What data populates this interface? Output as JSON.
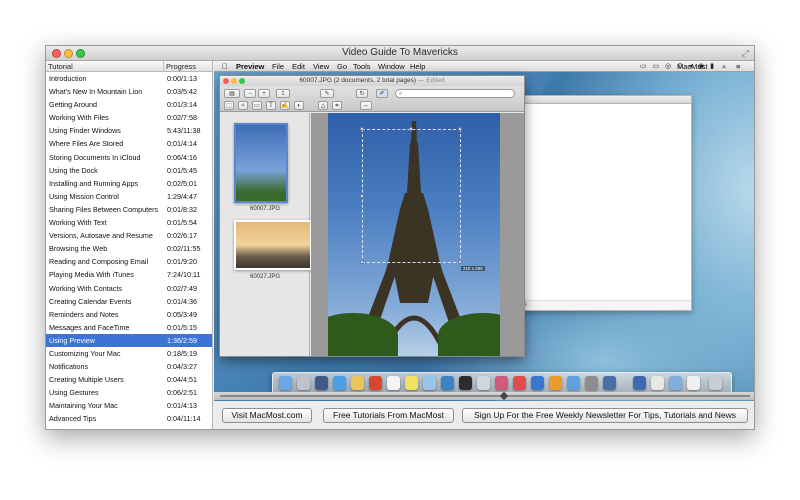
{
  "window": {
    "title": "Video Guide To Mavericks"
  },
  "sidebar": {
    "header_tutorial": "Tutorial",
    "header_progress": "Progress",
    "rows": [
      {
        "name": "Introduction",
        "progress": "0:00/1:13"
      },
      {
        "name": "What's New In Mountain Lion",
        "progress": "0:03/5:42"
      },
      {
        "name": "Getting Around",
        "progress": "0:01/3:14"
      },
      {
        "name": "Working With Files",
        "progress": "0:02/7:58"
      },
      {
        "name": "Using Finder Windows",
        "progress": "5:43/11:38"
      },
      {
        "name": "Where Files Are Stored",
        "progress": "0:01/4:14"
      },
      {
        "name": "Storing Documents In iCloud",
        "progress": "0:06/4:16"
      },
      {
        "name": "Using the Dock",
        "progress": "0:01/5:45"
      },
      {
        "name": "Installing and Running Apps",
        "progress": "0:02/5:01"
      },
      {
        "name": "Using Mission Control",
        "progress": "1:29/4:47"
      },
      {
        "name": "Sharing Files Between Computers",
        "progress": "0:01/8:32"
      },
      {
        "name": "Working With Text",
        "progress": "0:01/5:54"
      },
      {
        "name": "Versions, Autosave and Resume",
        "progress": "0:02/6:17"
      },
      {
        "name": "Browsing the Web",
        "progress": "0:02/11:55"
      },
      {
        "name": "Reading and Composing Email",
        "progress": "0:01/9:20"
      },
      {
        "name": "Playing Media With iTunes",
        "progress": "7:24/10:11"
      },
      {
        "name": "Working With Contacts",
        "progress": "0:02/7:49"
      },
      {
        "name": "Creating Calendar Events",
        "progress": "0:01/4:36"
      },
      {
        "name": "Reminders and Notes",
        "progress": "0:05/3:49"
      },
      {
        "name": "Messages and FaceTime",
        "progress": "0:01/5:15"
      },
      {
        "name": "Using Preview",
        "progress": "1:36/2:59"
      },
      {
        "name": "Customizing Your Mac",
        "progress": "0:18/5:19"
      },
      {
        "name": "Notifications",
        "progress": "0:04/3:27"
      },
      {
        "name": "Creating Multiple Users",
        "progress": "0:04/4:51"
      },
      {
        "name": "Using Gestures",
        "progress": "0:06/2:51"
      },
      {
        "name": "Maintaining Your Mac",
        "progress": "0:01/4:13"
      },
      {
        "name": "Advanced Tips",
        "progress": "0:04/11:14"
      }
    ],
    "selected_index": 20,
    "selection_color": "#3b73d7"
  },
  "menubar": {
    "app": "Preview",
    "items": [
      "File",
      "Edit",
      "View",
      "Go",
      "Tools",
      "Window",
      "Help"
    ],
    "user": "MacMost"
  },
  "preview_window": {
    "title": "60007.JPG (2 documents, 2 total pages)",
    "edited_tag": "Edited",
    "thumbnails": [
      {
        "label": "60007.JPG"
      },
      {
        "label": "60027.JPG"
      }
    ],
    "selection_size": "215 x 296"
  },
  "background_window": {
    "footer": "ffts"
  },
  "video": {
    "progress_fraction": 0.537
  },
  "buttons": {
    "visit": "Visit MacMost.com",
    "free": "Free Tutorials From MacMost",
    "signup": "Sign Up For the Free Weekly Newsletter For Tips, Tutorials and News"
  }
}
